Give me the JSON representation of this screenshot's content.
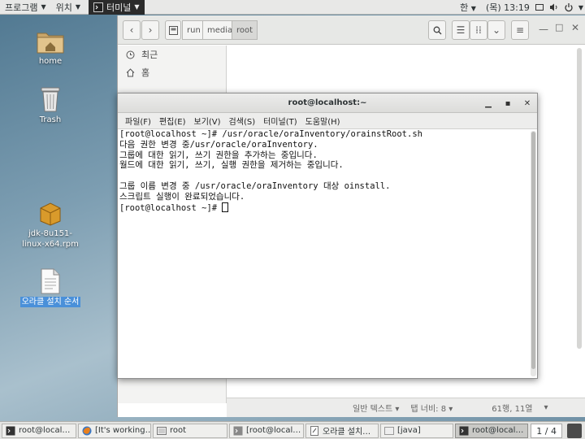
{
  "topbar": {
    "programs": "프로그램",
    "places": "위치",
    "active_app": "터미널",
    "input_method": "한",
    "clock": "(목) 13:19"
  },
  "desktop": {
    "icons": [
      {
        "label": "home",
        "icon": "home-folder-icon"
      },
      {
        "label": "Trash",
        "icon": "trash-icon"
      },
      {
        "label": "jdk-8u151-linux-x64.rpm",
        "icon": "package-icon"
      },
      {
        "label": "오라클 설치 순서",
        "icon": "text-file-icon"
      }
    ]
  },
  "file_manager": {
    "breadcrumbs": [
      "run",
      "media",
      "root"
    ],
    "active_crumb": "root",
    "sidebar": [
      {
        "label": "최근",
        "icon": "clock-icon"
      },
      {
        "label": "홈",
        "icon": "home-icon"
      }
    ],
    "status": {
      "text_type": "일반 텍스트",
      "tab_width": "탭 너비: 8",
      "position": "61행, 11열"
    }
  },
  "terminal": {
    "title": "root@localhost:~",
    "menu": [
      "파일(F)",
      "편집(E)",
      "보기(V)",
      "검색(S)",
      "터미널(T)",
      "도움말(H)"
    ],
    "lines": [
      "[root@localhost ~]# /usr/oracle/oraInventory/orainstRoot.sh",
      "다음 권한 변경 중/usr/oracle/oraInventory.",
      "그룹에 대한 읽기, 쓰기 권한을 추가하는 중입니다.",
      "월드에 대한 읽기, 쓰기, 실행 권한을 제거하는 중입니다.",
      "",
      "그룹 이름 변경 중 /usr/oracle/oraInventory 대상 oinstall.",
      "스크립트 실행이 완료되었습니다.",
      "[root@localhost ~]# "
    ]
  },
  "taskbar": {
    "tasks": [
      {
        "label": "root@local…",
        "icon": "terminal-icon"
      },
      {
        "label": "[It's working…",
        "icon": "firefox-icon"
      },
      {
        "label": "root",
        "icon": "folder-icon"
      },
      {
        "label": "[root@local…",
        "icon": "terminal-icon"
      },
      {
        "label": "오라클 설치…",
        "icon": "text-editor-icon"
      },
      {
        "label": "[java]",
        "icon": "folder-icon"
      },
      {
        "label": "root@local…",
        "icon": "terminal-icon"
      }
    ],
    "workspace": "1 / 4"
  },
  "colors": {
    "selection": "#4a90d9",
    "terminal_bg": "#ffffff",
    "topbar_bg": "#e8e8e7"
  }
}
